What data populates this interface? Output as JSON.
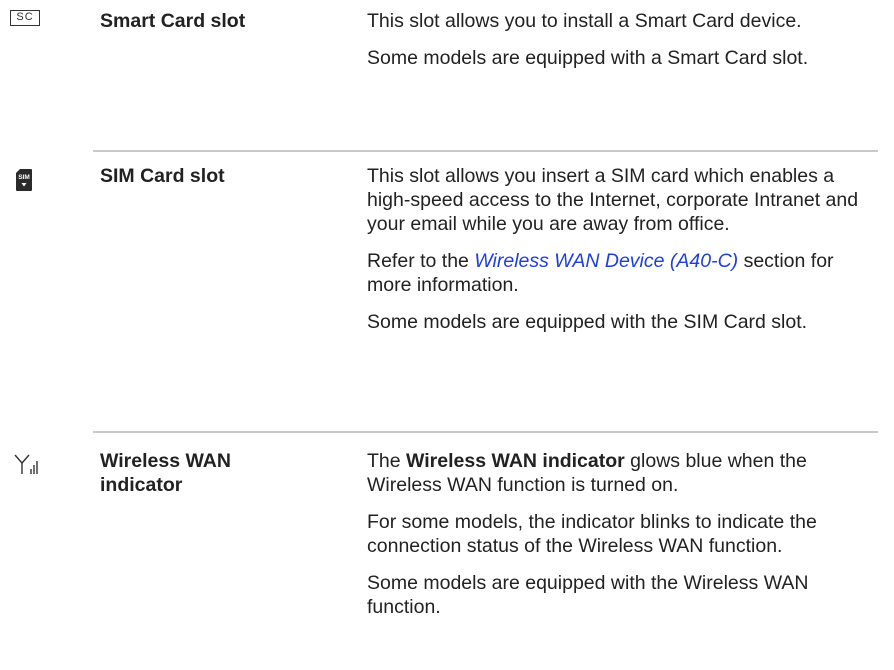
{
  "rows": [
    {
      "icon": "smart-card-icon",
      "icon_label": "SC",
      "term": "Smart Card slot",
      "paragraphs": [
        "This slot allows you to install a Smart Card device.",
        "Some models are equipped with a Smart Card slot."
      ]
    },
    {
      "icon": "sim-card-icon",
      "icon_label": "SIM",
      "term": "SIM Card slot",
      "paragraphs": [
        "This slot allows you insert a SIM card which enables a high-speed access to the Internet, corporate Intranet and your email while you are away from office."
      ],
      "refer": {
        "before": "Refer to the ",
        "link": "Wireless WAN Device (A40-C)",
        "after": " section for more information."
      },
      "closing": "Some models are equipped with the SIM Card slot."
    },
    {
      "icon": "wireless-wan-antenna-icon",
      "term": "Wireless WAN indicator",
      "intro": {
        "before": "The ",
        "bold": "Wireless WAN indicator",
        "after": " glows blue when the Wireless WAN function is turned on."
      },
      "paragraphs": [
        "For some models, the indicator blinks to indicate the connection status of the Wireless WAN function.",
        "Some models are equipped with the Wireless WAN function."
      ]
    }
  ],
  "colors": {
    "text": "#222222",
    "link": "#1f3fdc",
    "rule": "#c9c9c9"
  }
}
